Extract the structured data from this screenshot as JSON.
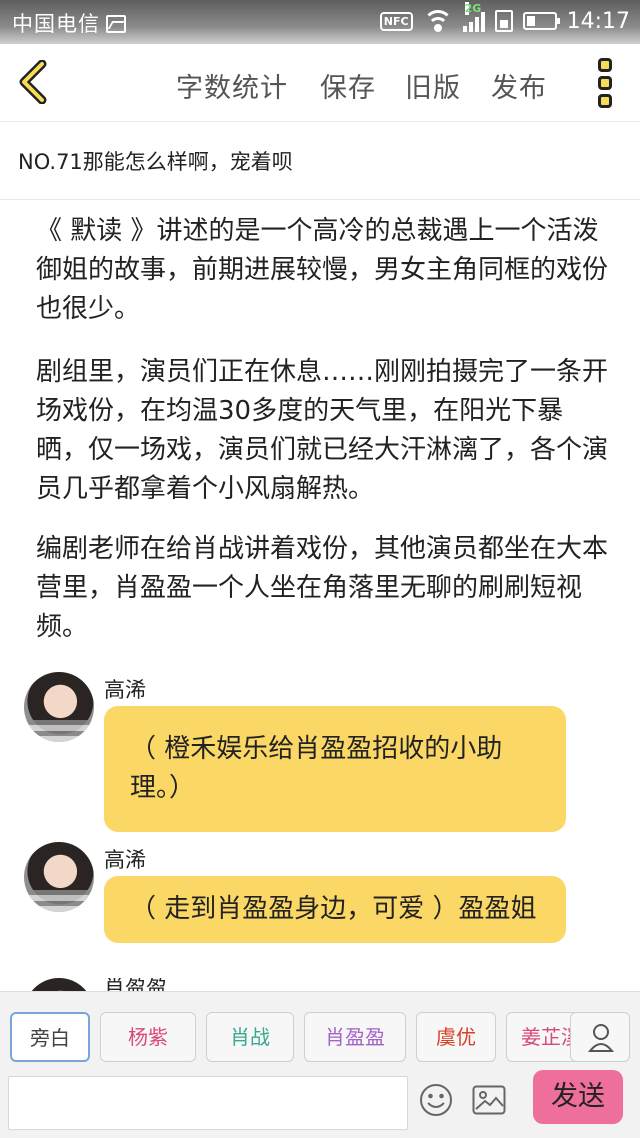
{
  "status_bar": {
    "carrier": "中国电信",
    "nfc": "NFC",
    "network": "2G",
    "time": "14:17"
  },
  "toolbar": {
    "word_count": "字数统计",
    "save": "保存",
    "old_version": "旧版",
    "publish": "发布"
  },
  "chapter_title": "NO.71那能怎么样啊，宠着呗",
  "narration": [
    "《 默读 》讲述的是一个高冷的总裁遇上一个活泼御姐的故事，前期进展较慢，男女主角同框的戏份也很少。",
    "剧组里，演员们正在休息……刚刚拍摄完了一条开场戏份，在均温30多度的天气里，在阳光下暴晒，仅一场戏，演员们就已经大汗淋漓了，各个演员几乎都拿着个小风扇解热。",
    "编剧老师在给肖战讲着戏份，其他演员都坐在大本营里，肖盈盈一个人坐在角落里无聊的刷刷短视频。"
  ],
  "messages": [
    {
      "speaker": "高浠",
      "text": "（ 橙禾娱乐给肖盈盈招收的小助理。）"
    },
    {
      "speaker": "高浠",
      "text": "（ 走到肖盈盈身边，可爱 ）盈盈姐"
    },
    {
      "speaker": "肖盈盈"
    }
  ],
  "roles": [
    {
      "label": "旁白",
      "color": "#444444"
    },
    {
      "label": "杨紫",
      "color": "#d9487a"
    },
    {
      "label": "肖战",
      "color": "#39a88f"
    },
    {
      "label": "肖盈盈",
      "color": "#a463c9"
    },
    {
      "label": "虞优",
      "color": "#d9402a"
    },
    {
      "label": "姜芷溪",
      "color": "#d9487a"
    }
  ],
  "composer": {
    "input_value": "",
    "send": "发送"
  },
  "icons": [
    "back-icon",
    "more-icon",
    "user-icon",
    "emoji-icon",
    "image-icon"
  ]
}
